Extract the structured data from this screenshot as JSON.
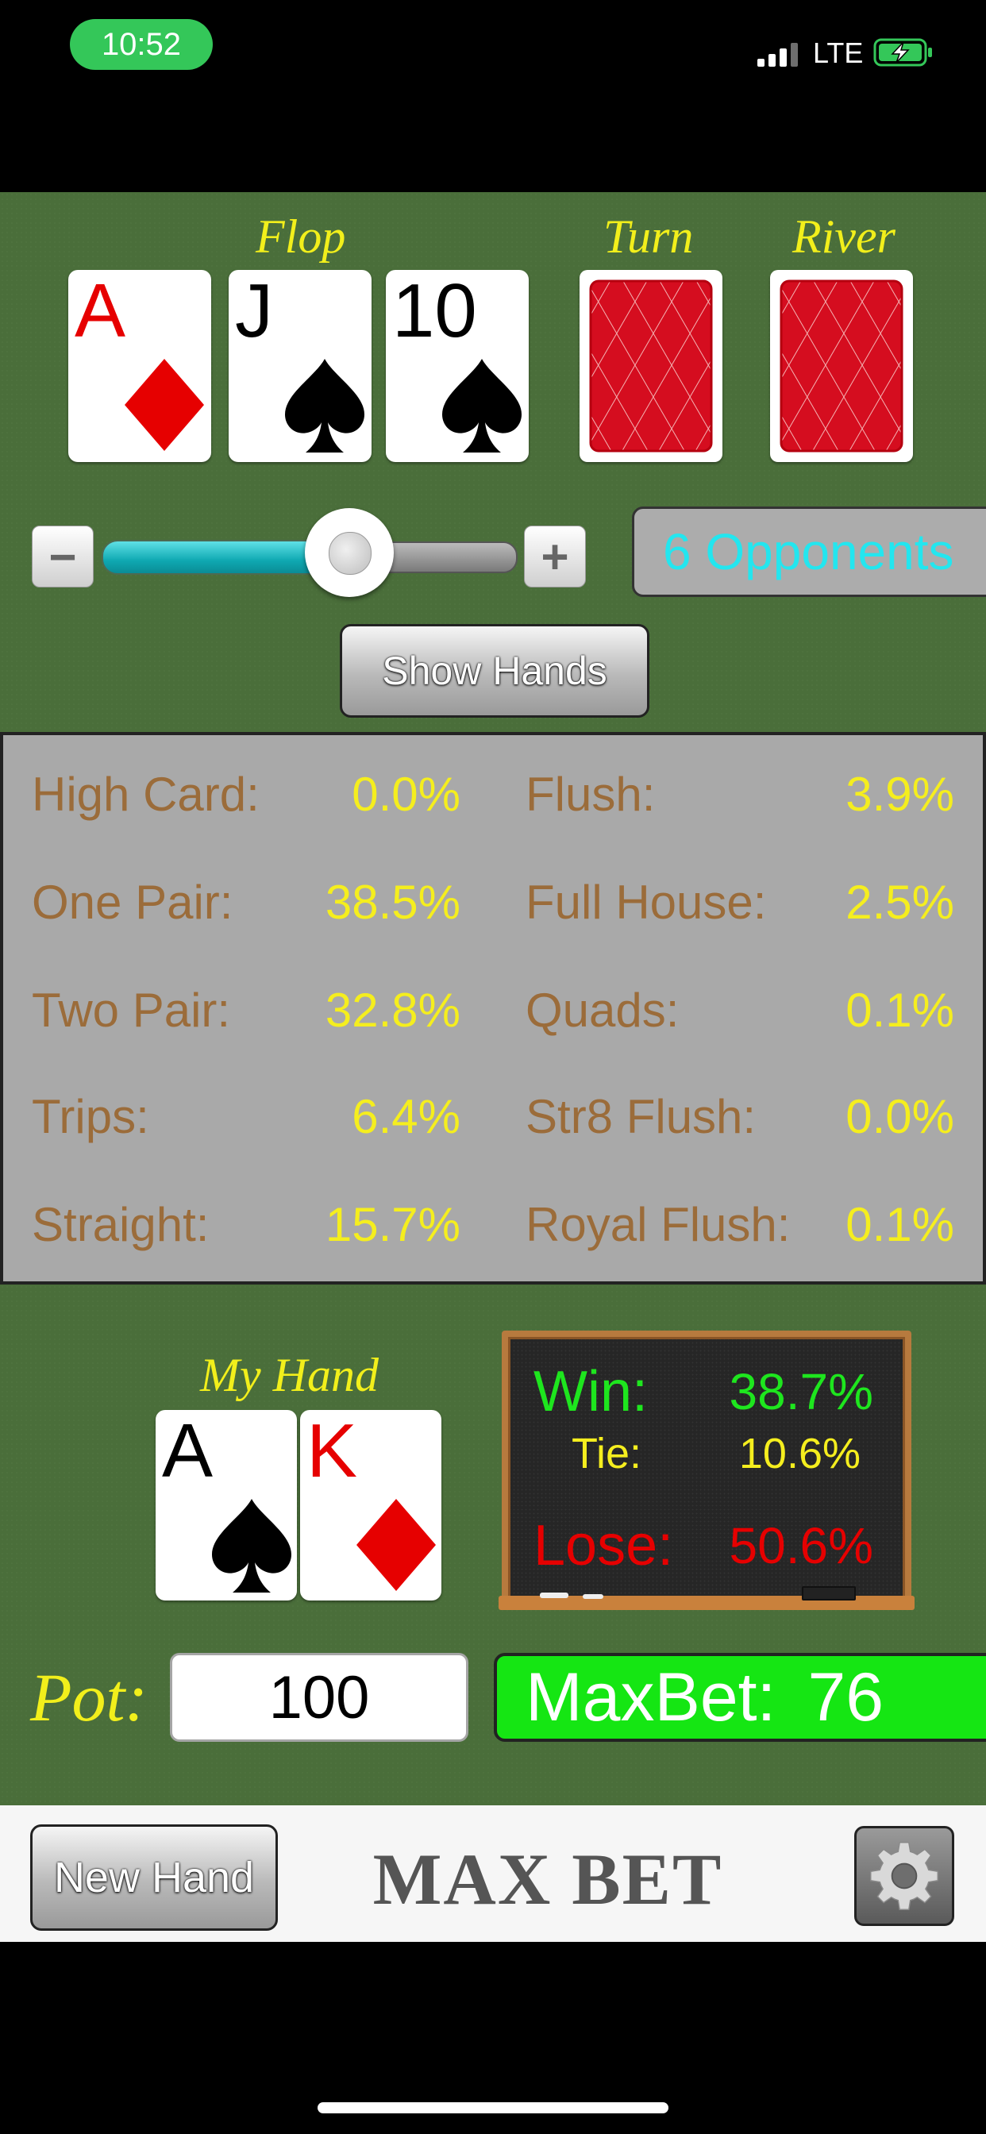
{
  "status_bar": {
    "time": "10:52",
    "network": "LTE"
  },
  "board": {
    "flop_label": "Flop",
    "turn_label": "Turn",
    "river_label": "River",
    "flop_cards": [
      {
        "rank": "A",
        "suit": "diamond"
      },
      {
        "rank": "J",
        "suit": "spade"
      },
      {
        "rank": "10",
        "suit": "spade"
      }
    ]
  },
  "controls": {
    "minus_label": "−",
    "plus_label": "+",
    "opponents_value_fraction": 0.5,
    "opponents_label": "6 Opponents",
    "show_hands_label": "Show Hands"
  },
  "hand_stats": [
    {
      "label": "High Card:",
      "value": "0.0%"
    },
    {
      "label": "Flush:",
      "value": "3.9%"
    },
    {
      "label": "One Pair:",
      "value": "38.5%"
    },
    {
      "label": "Full House:",
      "value": "2.5%"
    },
    {
      "label": "Two Pair:",
      "value": "32.8%"
    },
    {
      "label": "Quads:",
      "value": "0.1%"
    },
    {
      "label": "Trips:",
      "value": "6.4%"
    },
    {
      "label": "Str8 Flush:",
      "value": "0.0%"
    },
    {
      "label": "Straight:",
      "value": "15.7%"
    },
    {
      "label": "Royal Flush:",
      "value": "0.1%"
    }
  ],
  "my_hand": {
    "label": "My Hand",
    "cards": [
      {
        "rank": "A",
        "suit": "spade"
      },
      {
        "rank": "K",
        "suit": "diamond"
      }
    ]
  },
  "odds": {
    "win_label": "Win:",
    "win_value": "38.7%",
    "tie_label": "Tie:",
    "tie_value": "10.6%",
    "lose_label": "Lose:",
    "lose_value": "50.6%"
  },
  "betting": {
    "pot_label": "Pot:",
    "pot_value": "100",
    "maxbet_label": "MaxBet:",
    "maxbet_value": "76"
  },
  "footer": {
    "new_hand_label": "New Hand",
    "brand": "MAX BET"
  },
  "colors": {
    "felt": "#4a6e3a",
    "label_yellow": "#f2ef1b",
    "stat_label": "#9b6c3a",
    "stat_value": "#f5ee1e",
    "win_green": "#1ee61e",
    "lose_red": "#e60000",
    "maxbet_green": "#15e613",
    "opponents_cyan": "#23e6ef"
  }
}
